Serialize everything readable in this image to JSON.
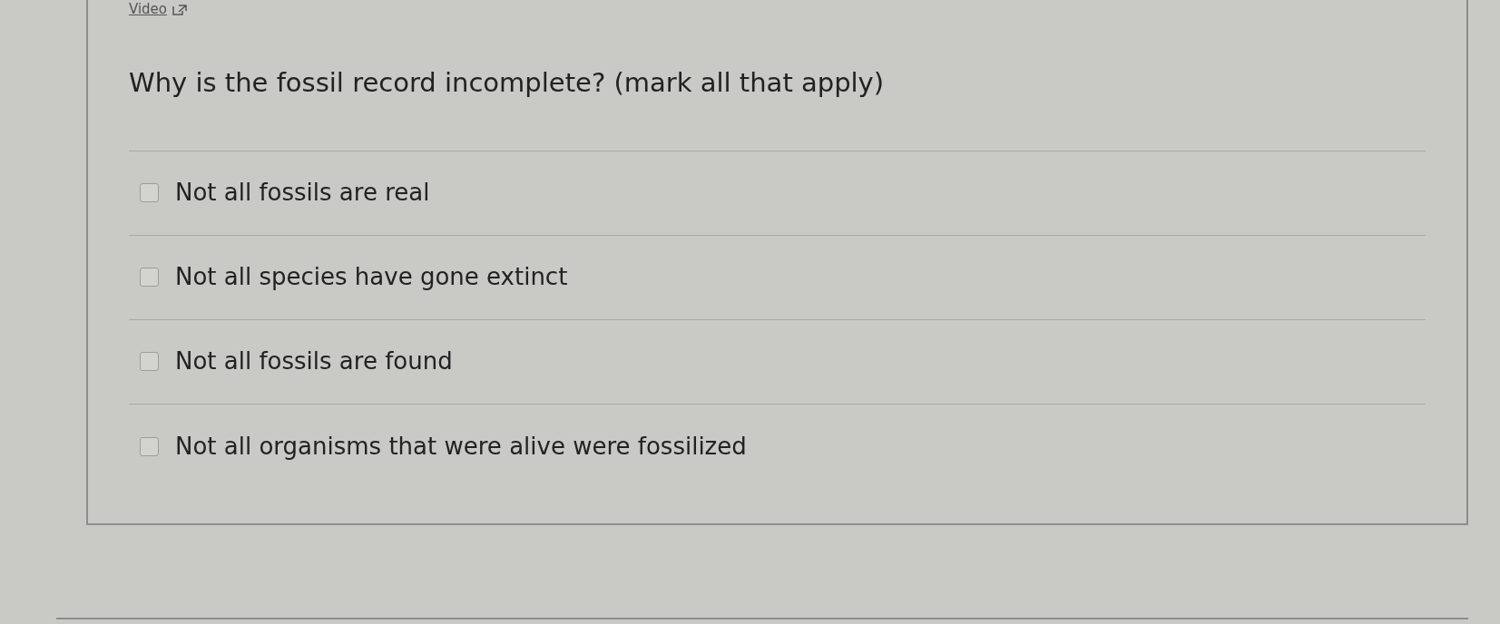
{
  "video_link": {
    "label": "Video"
  },
  "question": "Why is the fossil record incomplete? (mark all that apply)",
  "options": [
    {
      "label": "Not all fossils are real",
      "checked": false
    },
    {
      "label": "Not all species have gone extinct",
      "checked": false
    },
    {
      "label": "Not all fossils are found",
      "checked": false
    },
    {
      "label": "Not all organisms that were alive were fossilized",
      "checked": false
    }
  ]
}
